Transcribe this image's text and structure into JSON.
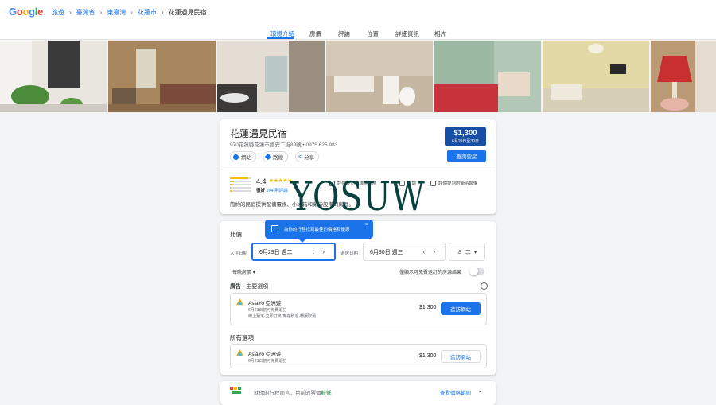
{
  "header": {
    "logo": "Google",
    "breadcrumbs": [
      "旅遊",
      "臺灣省",
      "東臺灣",
      "花蓮市",
      "花蓮遇見民宿"
    ]
  },
  "tabs": [
    "環境介紹",
    "房價",
    "評論",
    "位置",
    "詳細資訊",
    "相片"
  ],
  "hotel": {
    "name": "花蓮遇見民宿",
    "address": "970花蓮縣花蓮市德安二街89號 • 0975 625 983",
    "chips": [
      "網站",
      "路線",
      "分享"
    ],
    "price": "$1,300",
    "price_dates": "6月29日至30日",
    "check_button": "查詢空房",
    "rating": "4.4",
    "stars": 4.4,
    "rating_label": "很好",
    "review_count": "104 則評論",
    "rating_bars": [
      0.85,
      0.2,
      0.1,
      0.05,
      0.12
    ],
    "amenities": [
      "評價提到的環境氛圍",
      "空調",
      "評價提到的衛浴設備"
    ],
    "description": "簡約的民宿提供配備電視、小冰箱和衛浴設備的房間。"
  },
  "watermark": "YOSUW",
  "compare": {
    "title": "比價",
    "tooltip": "為你的行程找到最佳的價格和優惠",
    "close": "×",
    "checkin_label": "入住日期",
    "checkin_value": "6月29日 週二",
    "checkout_label": "退房日期",
    "checkout_value": "6月30日 週三",
    "guests": "二",
    "nightly_label": "每晚房價",
    "free_cancel_label": "僅顯示可免費退訂的房源結果",
    "ads_label": "廣告",
    "ads_sub": "· 主要選項",
    "all_label": "所有選項",
    "info_icon": "i"
  },
  "offers": [
    {
      "name": "AsiaYo 亞洲遊",
      "line1": "6月23日前可免費退訂",
      "line2": "線上預定·立即訂房·實存秒退·轉讓取消",
      "price": "$1,300",
      "button": "造訪網站"
    },
    {
      "name": "AsiaYo 亞洲遊",
      "line1": "6月23日前可免費退訂",
      "price": "$1,300",
      "button": "造訪網站"
    }
  ],
  "bottom": {
    "text": "就你的行程而言，目前的票價",
    "text_green": "較低",
    "link": "查看價格範圍"
  },
  "colors": {
    "accent": "#1a73e8",
    "price_box": "#174ea6",
    "star": "#fbbc04",
    "watermark": "#08423e"
  }
}
